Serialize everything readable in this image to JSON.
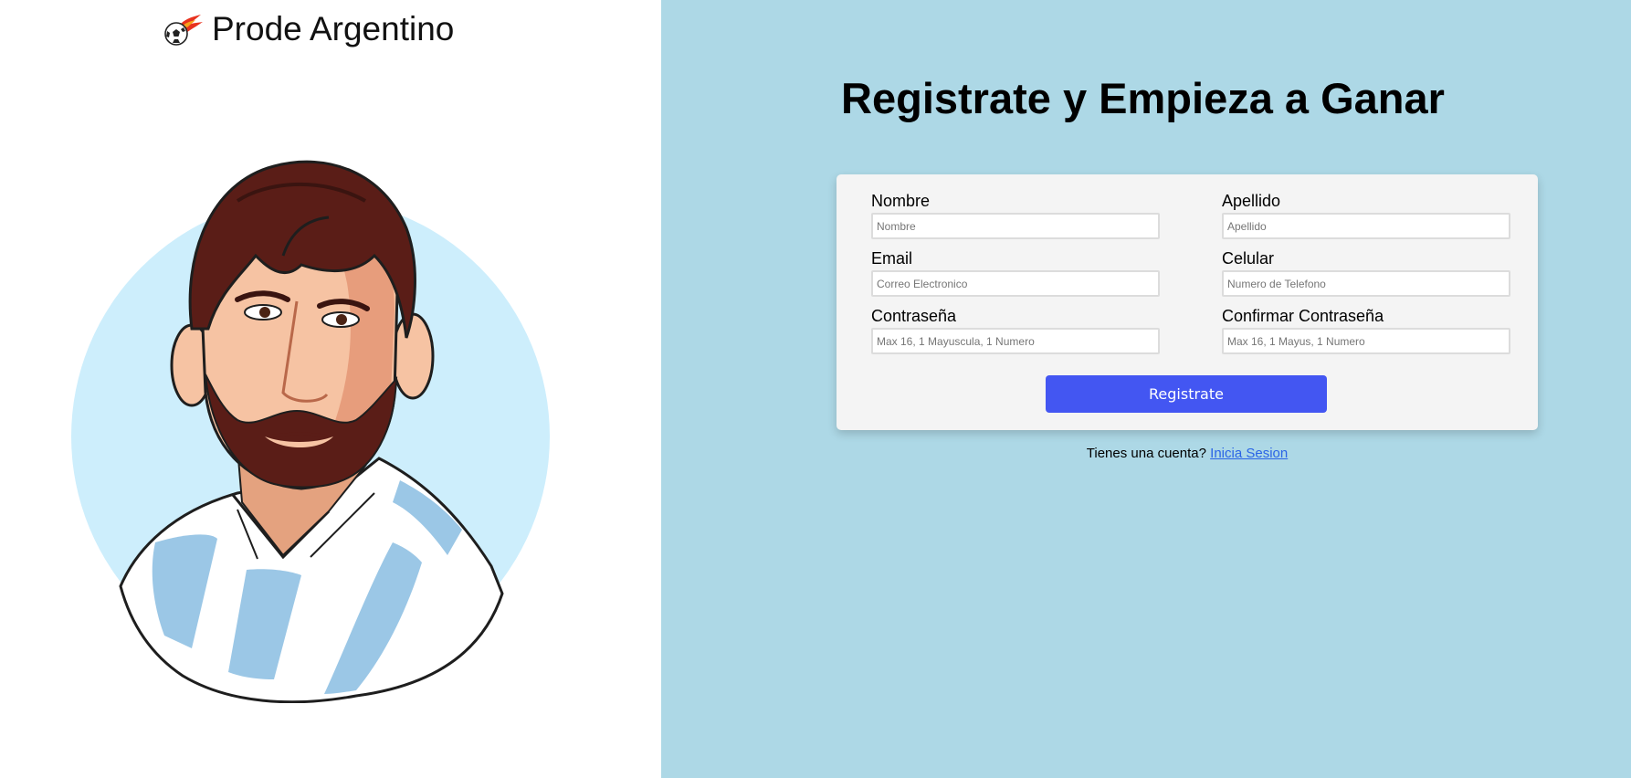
{
  "brand": {
    "title": "Prode Argentino",
    "logo_icon": "flaming-soccer-ball-icon"
  },
  "illustration": {
    "icon": "footballer-portrait-illustration",
    "circle_color": "#cdeefc",
    "stripe_color": "#9bc7e6"
  },
  "register": {
    "heading": "Registrate y Empieza a Ganar",
    "fields": {
      "nombre": {
        "label": "Nombre",
        "placeholder": "Nombre"
      },
      "apellido": {
        "label": "Apellido",
        "placeholder": "Apellido"
      },
      "email": {
        "label": "Email",
        "placeholder": "Correo Electronico"
      },
      "celular": {
        "label": "Celular",
        "placeholder": "Numero de Telefono"
      },
      "password": {
        "label": "Contraseña",
        "placeholder": "Max 16, 1 Mayuscula, 1 Numero"
      },
      "confirm_password": {
        "label": "Confirmar Contraseña",
        "placeholder": "Max 16, 1 Mayus, 1 Numero"
      }
    },
    "submit_label": "Registrate",
    "login_prompt": "Tienes una cuenta?",
    "login_link": "Inicia Sesion"
  },
  "colors": {
    "right_background": "#add8e6",
    "card_background": "#f4f4f4",
    "button": "#4356f2",
    "link": "#2a64e6"
  }
}
